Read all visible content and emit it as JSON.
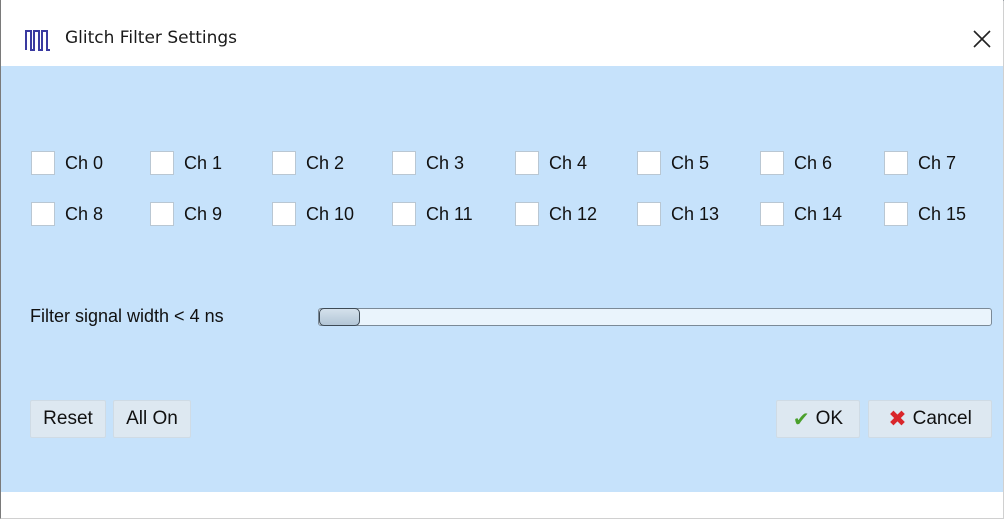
{
  "window": {
    "title": "Glitch Filter Settings",
    "icon": "glitch-pulse-icon",
    "close_icon": "close-icon"
  },
  "channels": {
    "row0": [
      {
        "label": "Ch 0",
        "checked": false
      },
      {
        "label": "Ch 1",
        "checked": false
      },
      {
        "label": "Ch 2",
        "checked": false
      },
      {
        "label": "Ch 3",
        "checked": false
      },
      {
        "label": "Ch 4",
        "checked": false
      },
      {
        "label": "Ch 5",
        "checked": false
      },
      {
        "label": "Ch 6",
        "checked": false
      },
      {
        "label": "Ch 7",
        "checked": false
      }
    ],
    "row1": [
      {
        "label": "Ch 8",
        "checked": false
      },
      {
        "label": "Ch 9",
        "checked": false
      },
      {
        "label": "Ch 10",
        "checked": false
      },
      {
        "label": "Ch 11",
        "checked": false
      },
      {
        "label": "Ch 12",
        "checked": false
      },
      {
        "label": "Ch 13",
        "checked": false
      },
      {
        "label": "Ch 14",
        "checked": false
      },
      {
        "label": "Ch 15",
        "checked": false
      }
    ]
  },
  "filter": {
    "label": "Filter signal width < 4 ns",
    "slider_fraction": 0.0
  },
  "buttons": {
    "reset": "Reset",
    "all_on": "All On",
    "ok": "OK",
    "ok_icon": "checkmark-icon",
    "cancel": "Cancel",
    "cancel_icon": "x-mark-icon"
  },
  "colors": {
    "client_bg": "#c6e2fb",
    "ok_check": "#4aa02c",
    "cancel_x": "#d9262b",
    "title_icon": "#3a3aa0"
  }
}
